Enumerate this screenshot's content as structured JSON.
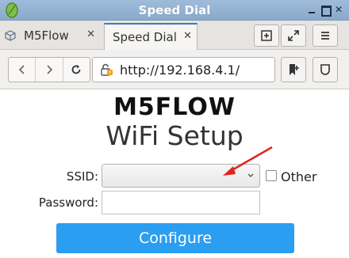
{
  "window": {
    "title": "Speed Dial"
  },
  "tabs": [
    {
      "label": "M5Flow",
      "close": "✕",
      "active": false
    },
    {
      "label": "Speed Dial",
      "close": "✕",
      "active": true
    }
  ],
  "navbar": {
    "url": "http://192.168.4.1/"
  },
  "page": {
    "brand": "M5FLOW",
    "subtitle": "WiFi Setup",
    "ssid_label": "SSID:",
    "ssid_value": "",
    "other_label": "Other",
    "password_label": "Password:",
    "password_value": "",
    "configure_label": "Configure"
  },
  "colors": {
    "titlebar": "#9fbbd9",
    "accent": "#2a9ef1",
    "annotation_arrow": "#e2231a"
  },
  "icons": {
    "app": "leaf-icon",
    "tab_inactive": "cube-icon",
    "lock": "insecure-lock-icon"
  }
}
